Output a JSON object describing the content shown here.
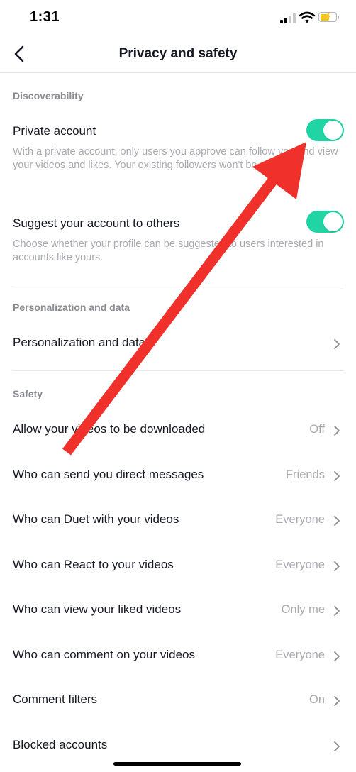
{
  "status_bar": {
    "time": "1:31"
  },
  "header": {
    "title": "Privacy and safety"
  },
  "discoverability": {
    "title": "Discoverability",
    "private_account": {
      "label": "Private account",
      "description": "With a private account, only users you approve can follow you and view your videos and likes. Your existing followers won't be affected.",
      "enabled": true
    },
    "suggest_account": {
      "label": "Suggest your account to others",
      "description": "Choose whether your profile can be suggested to users interested in accounts like yours.",
      "enabled": true
    }
  },
  "personalization": {
    "title": "Personalization and data",
    "item_label": "Personalization and data"
  },
  "safety": {
    "title": "Safety",
    "items": [
      {
        "label": "Allow your videos to be downloaded",
        "value": "Off"
      },
      {
        "label": "Who can send you direct messages",
        "value": "Friends"
      },
      {
        "label": "Who can Duet with your videos",
        "value": "Everyone"
      },
      {
        "label": "Who can React to your videos",
        "value": "Everyone"
      },
      {
        "label": "Who can view your liked videos",
        "value": "Only me"
      },
      {
        "label": "Who can comment on your videos",
        "value": "Everyone"
      },
      {
        "label": "Comment filters",
        "value": "On"
      },
      {
        "label": "Blocked accounts",
        "value": ""
      }
    ]
  },
  "colors": {
    "toggle_on": "#20d5a3",
    "annotation_arrow": "#f0302a",
    "battery": "#f0c419"
  }
}
